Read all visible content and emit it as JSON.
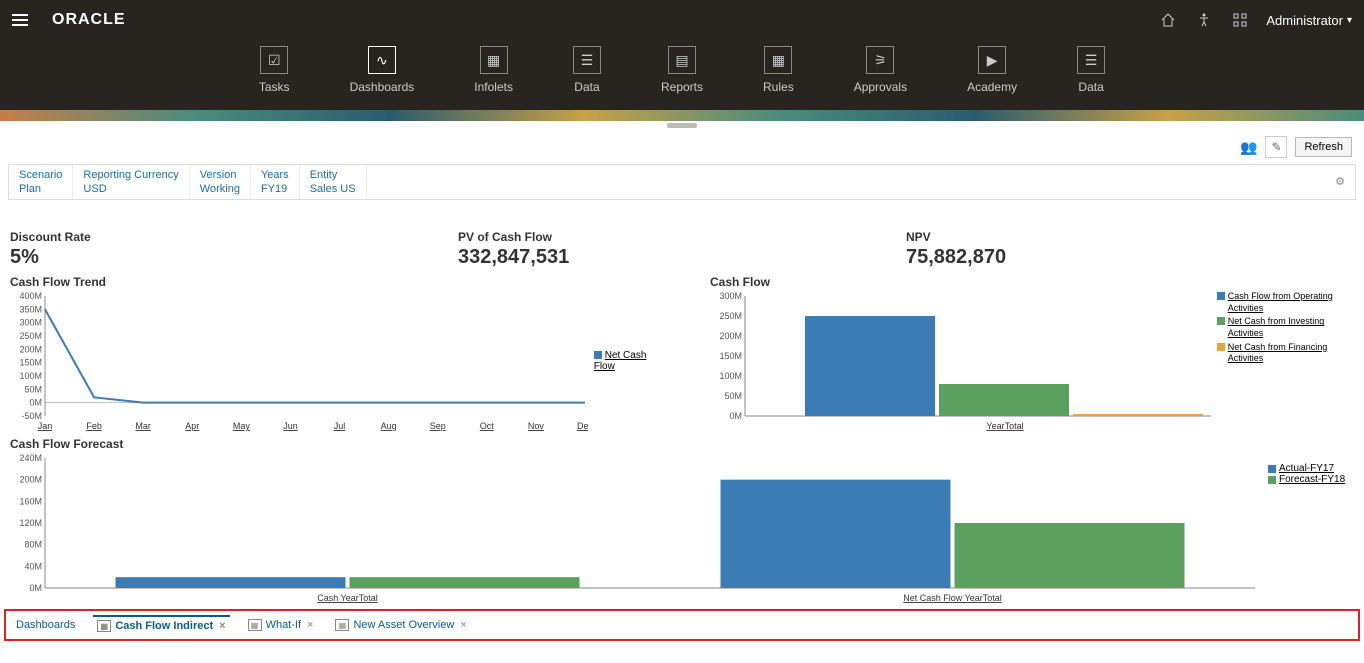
{
  "header": {
    "logo": "ORACLE",
    "user": "Administrator"
  },
  "nav": [
    {
      "label": "Tasks"
    },
    {
      "label": "Dashboards"
    },
    {
      "label": "Infolets"
    },
    {
      "label": "Data"
    },
    {
      "label": "Reports"
    },
    {
      "label": "Rules"
    },
    {
      "label": "Approvals"
    },
    {
      "label": "Academy"
    },
    {
      "label": "Data"
    }
  ],
  "actions": {
    "refresh": "Refresh"
  },
  "pov": [
    {
      "label": "Scenario",
      "value": "Plan"
    },
    {
      "label": "Reporting Currency",
      "value": "USD"
    },
    {
      "label": "Version",
      "value": "Working"
    },
    {
      "label": "Years",
      "value": "FY19"
    },
    {
      "label": "Entity",
      "value": "Sales US"
    }
  ],
  "kpis": {
    "discount_label": "Discount Rate",
    "discount_value": "5%",
    "pv_label": "PV of Cash Flow",
    "pv_value": "332,847,531",
    "npv_label": "NPV",
    "npv_value": "75,882,870"
  },
  "trend": {
    "title": "Cash Flow Trend",
    "legend": "Net Cash Flow"
  },
  "cashflow": {
    "title": "Cash Flow",
    "legend1": "Cash Flow from Operating Activities",
    "legend2": "Net Cash from Investing Activities",
    "legend3": "Net Cash from Financing Activities",
    "xlabel": "YearTotal"
  },
  "forecast": {
    "title": "Cash Flow Forecast",
    "legend1": "Actual-FY17",
    "legend2": "Forecast-FY18",
    "xlabel1": "Cash YearTotal",
    "xlabel2": "Net Cash Flow YearTotal"
  },
  "tabs": {
    "root": "Dashboards",
    "t1": "Cash Flow Indirect",
    "t2": "What-If",
    "t3": "New Asset Overview"
  },
  "chart_data": [
    {
      "type": "line",
      "title": "Cash Flow Trend",
      "series": [
        {
          "name": "Net Cash Flow",
          "values": [
            350,
            20,
            0,
            0,
            0,
            0,
            0,
            0,
            0,
            0,
            0,
            0
          ]
        }
      ],
      "categories": [
        "Jan",
        "Feb",
        "Mar",
        "Apr",
        "May",
        "Jun",
        "Jul",
        "Aug",
        "Sep",
        "Oct",
        "Nov",
        "Dec"
      ],
      "ylabel": "",
      "ylim": [
        -50,
        400
      ],
      "yticks": [
        "-50M",
        "0M",
        "50M",
        "100M",
        "150M",
        "200M",
        "250M",
        "300M",
        "350M",
        "400M"
      ]
    },
    {
      "type": "bar",
      "title": "Cash Flow",
      "categories": [
        "YearTotal"
      ],
      "series": [
        {
          "name": "Cash Flow from Operating Activities",
          "value": 250,
          "color": "#3b7cb4"
        },
        {
          "name": "Net Cash from Investing Activities",
          "value": 80,
          "color": "#5ca060"
        },
        {
          "name": "Net Cash from Financing Activities",
          "value": 5,
          "color": "#e8a33d"
        }
      ],
      "ylim": [
        0,
        300
      ],
      "yticks": [
        "0M",
        "50M",
        "100M",
        "150M",
        "200M",
        "250M",
        "300M"
      ]
    },
    {
      "type": "bar",
      "title": "Cash Flow Forecast",
      "categories": [
        "Cash YearTotal",
        "Net Cash Flow YearTotal"
      ],
      "series": [
        {
          "name": "Actual-FY17",
          "values": [
            20,
            200
          ],
          "color": "#3b7cb4"
        },
        {
          "name": "Forecast-FY18",
          "values": [
            20,
            120
          ],
          "color": "#5ca060"
        }
      ],
      "ylim": [
        0,
        240
      ],
      "yticks": [
        "0M",
        "40M",
        "80M",
        "120M",
        "160M",
        "200M",
        "240M"
      ]
    }
  ]
}
